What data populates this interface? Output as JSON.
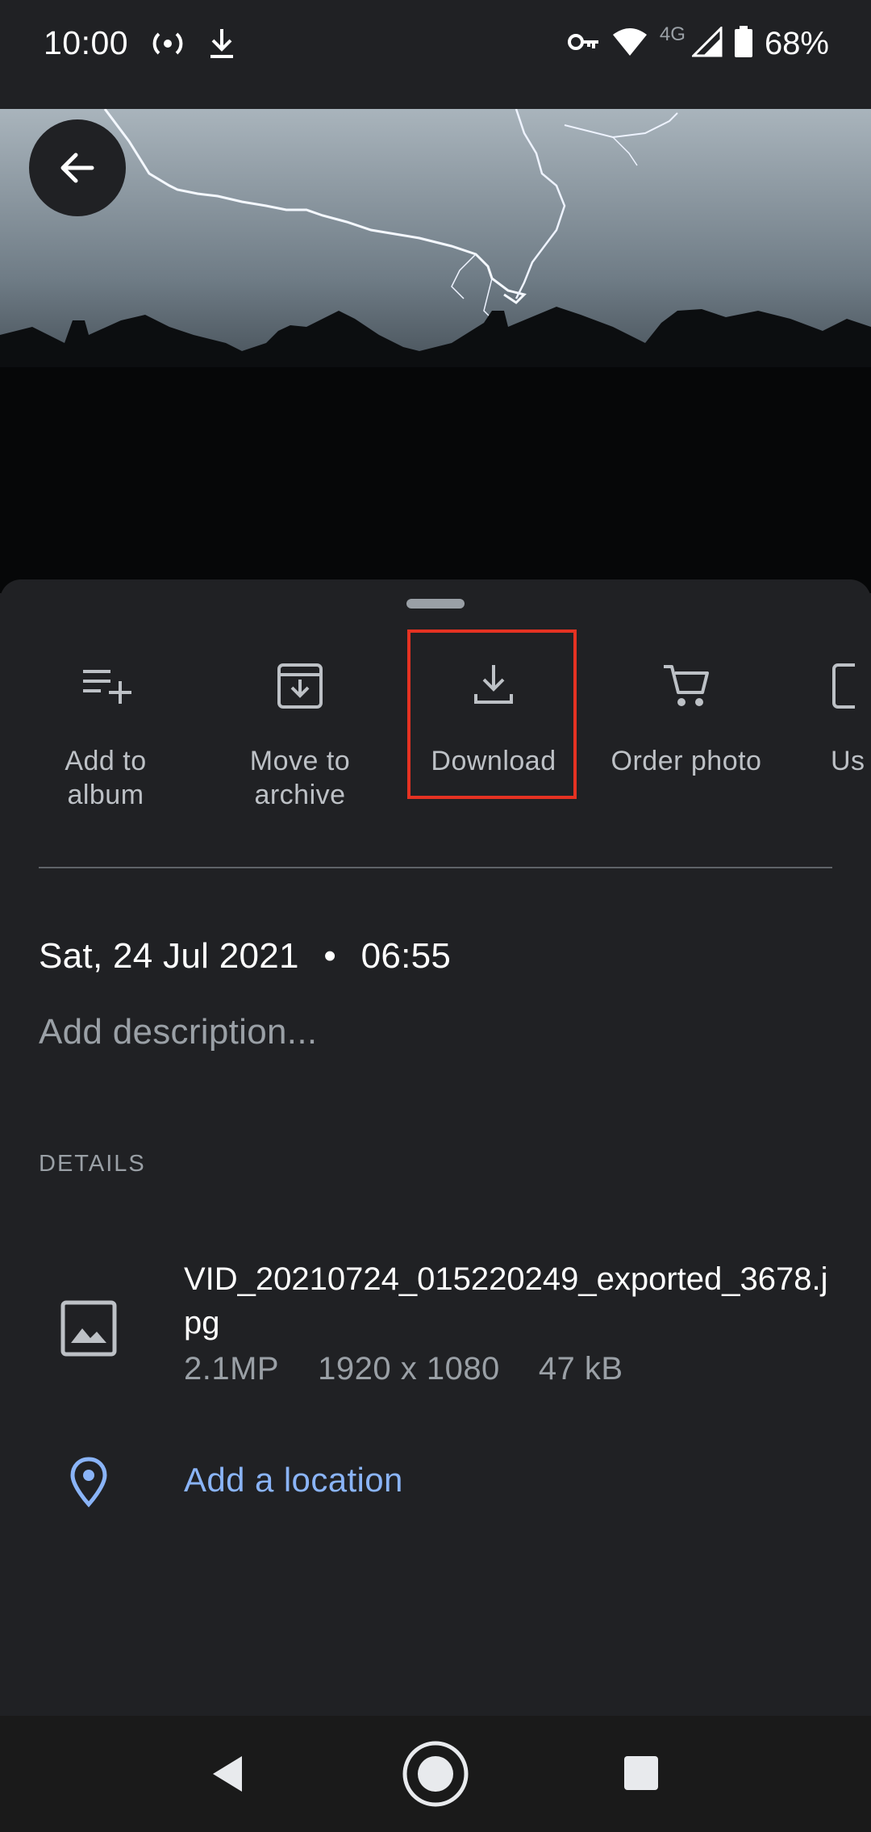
{
  "status_bar": {
    "time": "10:00",
    "network": "4G",
    "battery": "68%",
    "left_icons": [
      "hotspot-icon",
      "download-icon"
    ],
    "right_icons": [
      "vpn-key-icon",
      "wifi-icon",
      "cell-signal-icon",
      "battery-icon"
    ]
  },
  "photo": {
    "subject": "lightning-over-rooftops"
  },
  "back_button": {
    "icon": "arrow-left-icon"
  },
  "actions": [
    {
      "label": "Add to\nalbum",
      "icon": "playlist-add-icon"
    },
    {
      "label": "Move to\narchive",
      "icon": "archive-icon"
    },
    {
      "label": "Download",
      "icon": "download-icon",
      "highlighted": true
    },
    {
      "label": "Order photo",
      "icon": "cart-icon"
    },
    {
      "label": "Us",
      "icon": "partial-icon"
    }
  ],
  "info": {
    "date": "Sat, 24 Jul 2021",
    "separator": "•",
    "time": "06:55",
    "description_placeholder": "Add description..."
  },
  "details": {
    "header": "DETAILS",
    "file_name": "VID_20210724_015220249_exported_3678.jpg",
    "resolution_mp": "2.1MP",
    "dimensions": "1920 x 1080",
    "size": "47 kB",
    "location_label": "Add a location"
  },
  "colors": {
    "background": "#202124",
    "accent": "#8ab4f8",
    "highlight": "#e53222"
  },
  "nav_bar": {
    "icons": [
      "nav-back-icon",
      "nav-home-icon",
      "nav-recents-icon"
    ]
  }
}
